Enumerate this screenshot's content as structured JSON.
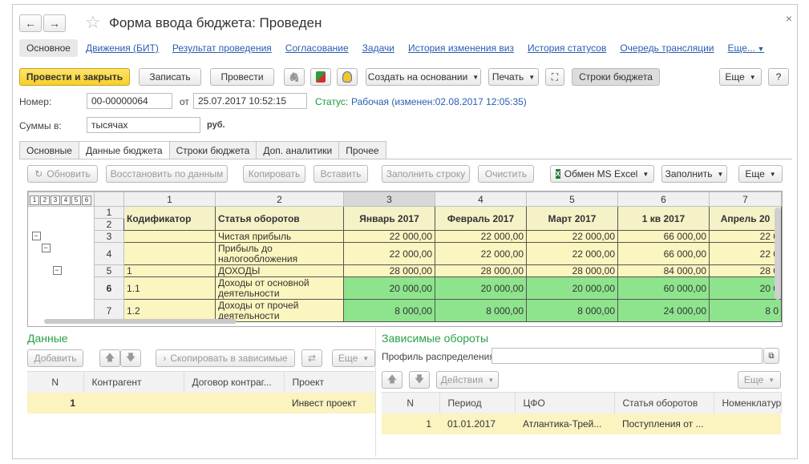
{
  "window": {
    "title": "Форма ввода бюджета: Проведен",
    "back_glyph": "←",
    "forward_glyph": "→",
    "star_glyph": "☆",
    "close_glyph": "×"
  },
  "top_links": [
    "Основное",
    "Движения (БИТ)",
    "Результат проведения",
    "Согласование",
    "Задачи",
    "История изменения виз",
    "История статусов",
    "Очередь трансляции",
    "Еще..."
  ],
  "toolbar": {
    "post_close": "Провести и закрыть",
    "save": "Записать",
    "post": "Провести",
    "clip_glyph": "🖇",
    "create_based": "Создать на основании",
    "print": "Печать",
    "expand_glyph": "⛶",
    "budget_rows": "Строки бюджета",
    "more": "Еще",
    "help": "?"
  },
  "form": {
    "number_label": "Номер:",
    "number_value": "00-00000064",
    "from_label": "от",
    "date_value": "25.07.2017 10:52:15",
    "status_label": "Статус:",
    "status_value": "Рабочая (изменен:02.08.2017 12:05:35)",
    "sums_label": "Суммы в:",
    "sums_value": "тысячах",
    "currency": "руб."
  },
  "tabs": [
    "Основные",
    "Данные бюджета",
    "Строки бюджета",
    "Доп. аналитики",
    "Прочее"
  ],
  "grid_toolbar": {
    "refresh": "Обновить",
    "restore": "Восстановить по данным",
    "copy": "Копировать",
    "paste": "Вставить",
    "fill_row": "Заполнить строку",
    "clear": "Очистить",
    "excel": "Обмен MS Excel",
    "fill": "Заполнить",
    "more": "Еще"
  },
  "grid": {
    "level_buttons": [
      "1",
      "2",
      "3",
      "4",
      "5",
      "6"
    ],
    "col_numbers": [
      "1",
      "2",
      "3",
      "4",
      "5",
      "6",
      "7"
    ],
    "headers": [
      "Кодификатор",
      "Статья оборотов",
      "Январь 2017",
      "Февраль 2017",
      "Март 2017",
      "1 кв 2017",
      "Апрель 20"
    ],
    "header_row_nums": [
      "1",
      "2"
    ],
    "rows": [
      {
        "n": "3",
        "code": "",
        "article": "Чистая прибыль",
        "values": [
          "22 000,00",
          "22 000,00",
          "22 000,00",
          "66 000,00",
          "22 0"
        ],
        "kind": "y"
      },
      {
        "n": "4",
        "code": "",
        "article": "Прибыль до налогообложения",
        "values": [
          "22 000,00",
          "22 000,00",
          "22 000,00",
          "66 000,00",
          "22 0"
        ],
        "kind": "y"
      },
      {
        "n": "5",
        "code": "1",
        "article": "ДОХОДЫ",
        "values": [
          "28 000,00",
          "28 000,00",
          "28 000,00",
          "84 000,00",
          "28 0"
        ],
        "kind": "y"
      },
      {
        "n": "6",
        "code": "1.1",
        "article": "Доходы от основной деятельности",
        "values": [
          "20 000,00",
          "20 000,00",
          "20 000,00",
          "60 000,00",
          "20 0"
        ],
        "kind": "g"
      },
      {
        "n": "7",
        "code": "1.2",
        "article": "Доходы от прочей деятельности",
        "values": [
          "8 000,00",
          "8 000,00",
          "8 000,00",
          "24 000,00",
          "8 0"
        ],
        "kind": "g"
      }
    ],
    "tree_minus": "−"
  },
  "data_panel": {
    "title": "Данные",
    "add": "Добавить",
    "copy_dep": "Скопировать в зависимые",
    "more": "Еще",
    "columns": [
      "N",
      "Контрагент",
      "Договор контраг...",
      "Проект"
    ],
    "rows": [
      [
        "1",
        "",
        "",
        "Инвест проект"
      ]
    ]
  },
  "dep_panel": {
    "title": "Зависимые обороты",
    "profile_label": "Профиль распределения:",
    "actions": "Действия",
    "more": "Еще",
    "columns": [
      "N",
      "Период",
      "ЦФО",
      "Статья оборотов",
      "Номенклатур"
    ],
    "rows": [
      [
        "1",
        "01.01.2017",
        "Атлантика-Трей...",
        "Поступления от ...",
        ""
      ]
    ]
  },
  "colors": {
    "primary_btn": "#f7cf2a",
    "link": "#2a5db0",
    "status_green": "#1a9a3a",
    "cell_yellow": "#fbf5bf",
    "cell_green": "#8de48d",
    "section_green": "#2aa04a",
    "selected_row": "#fbf3c0"
  }
}
